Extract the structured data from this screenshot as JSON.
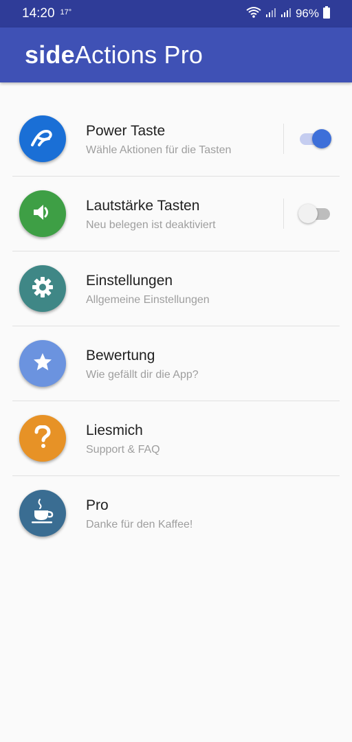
{
  "status_bar": {
    "time": "14:20",
    "temperature": "17°",
    "battery_percent": "96%",
    "icons": [
      "wifi-icon",
      "signal-icon",
      "signal-icon",
      "battery-icon"
    ]
  },
  "app_bar": {
    "title_bold": "side",
    "title_rest": "Actions Pro",
    "color": "#3f51b5"
  },
  "items": [
    {
      "title": "Power Taste",
      "subtitle": "Wähle Aktionen für die Tasten",
      "icon": "power-curve-icon",
      "color": "#1a6fd6",
      "toggle": true
    },
    {
      "title": "Lautstärke Tasten",
      "subtitle": "Neu belegen ist deaktiviert",
      "icon": "speaker-icon",
      "color": "#3e9f45",
      "toggle": false
    },
    {
      "title": "Einstellungen",
      "subtitle": "Allgemeine Einstellungen",
      "icon": "gear-icon",
      "color": "#3f8786"
    },
    {
      "title": "Bewertung",
      "subtitle": "Wie gefällt dir die App?",
      "icon": "star-icon",
      "color": "#6b93df"
    },
    {
      "title": "Liesmich",
      "subtitle": "Support & FAQ",
      "icon": "question-mark-icon",
      "color": "#e79226"
    },
    {
      "title": "Pro",
      "subtitle": "Danke für den Kaffee!",
      "icon": "coffee-cup-icon",
      "color": "#3a6d92"
    }
  ]
}
